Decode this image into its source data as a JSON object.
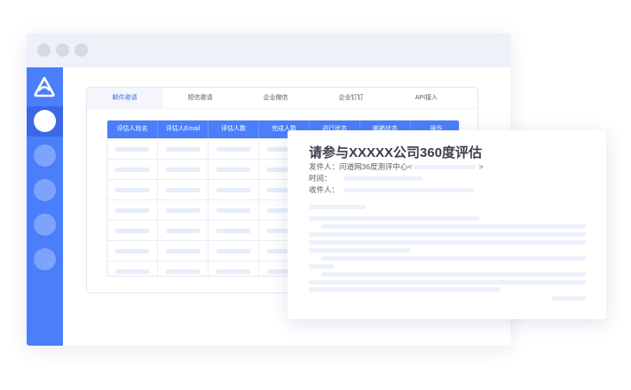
{
  "tabs": [
    {
      "label": "邮件邀请",
      "active": true
    },
    {
      "label": "短信邀请",
      "active": false
    },
    {
      "label": "企业微信",
      "active": false
    },
    {
      "label": "企业钉钉",
      "active": false
    },
    {
      "label": "API接入",
      "active": false
    }
  ],
  "table": {
    "columns": [
      "评估人姓名",
      "评估人Email",
      "评估人数",
      "完成人数",
      "进行状态",
      "邮箱状态",
      "操作"
    ],
    "placeholder_rows": 7
  },
  "email": {
    "title": "请参与XXXXX公司360度评估",
    "sender_label": "发件人：",
    "sender_value": "问道网36度测评中心<",
    "sender_value_end": ">",
    "time_label": "时间：",
    "recipient_label": "收件人："
  },
  "sidebar": {
    "logo_icon": "brand-logo-icon",
    "nav_count": 5,
    "active_index": 0
  },
  "colors": {
    "accent": "#4a7efb",
    "sidebar_active": "#3c68e6",
    "placeholder": "#e6edfb"
  }
}
